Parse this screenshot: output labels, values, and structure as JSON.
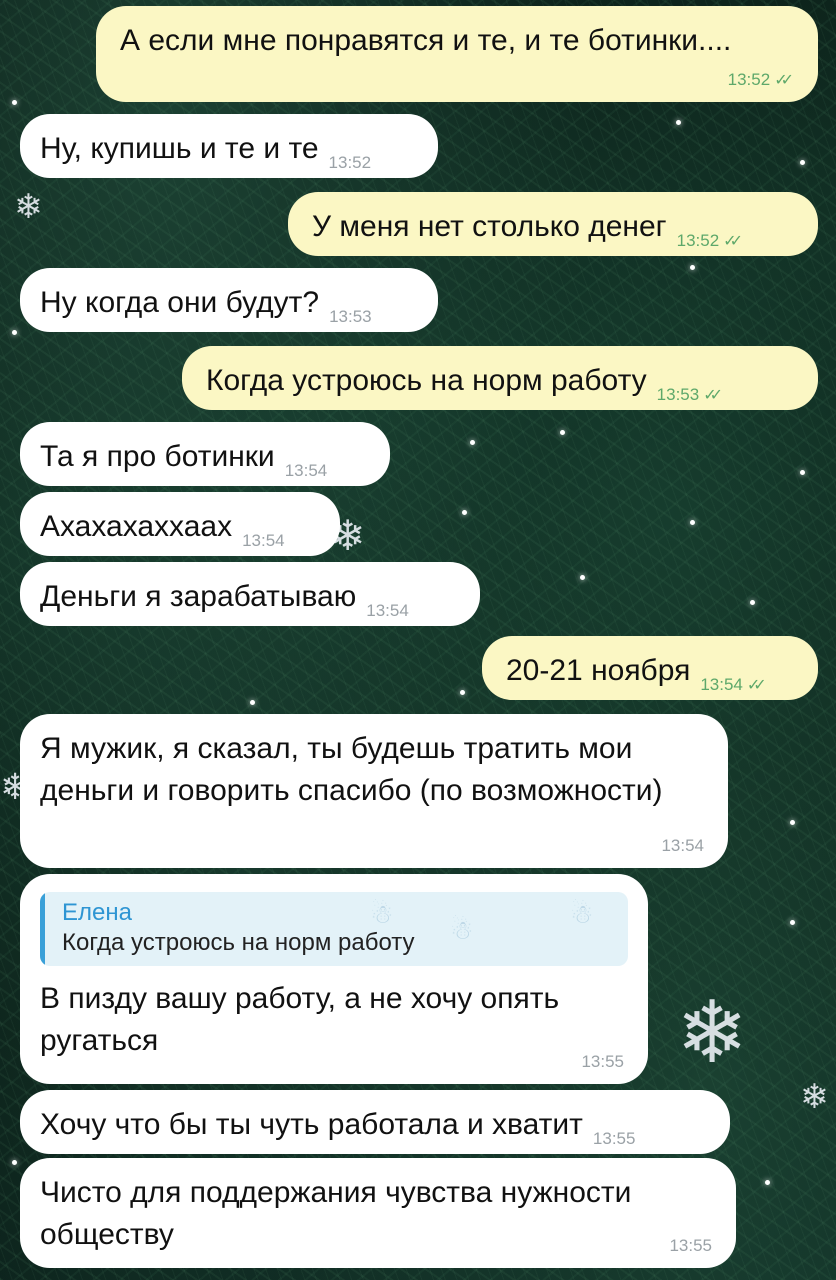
{
  "chat": {
    "messages": [
      {
        "text": "А если мне понравятся и те, и те ботинки....",
        "time": "13:52"
      },
      {
        "text": "Ну, купишь и те и те",
        "time": "13:52"
      },
      {
        "text": "У меня нет столько денег",
        "time": "13:52"
      },
      {
        "text": "Ну когда они будут?",
        "time": "13:53"
      },
      {
        "text": "Когда устроюсь на норм работу",
        "time": "13:53"
      },
      {
        "text": "Та я про ботинки",
        "time": "13:54"
      },
      {
        "text": "Ахахахаххаах",
        "time": "13:54"
      },
      {
        "text": "Деньги я зарабатываю",
        "time": "13:54"
      },
      {
        "text": "20-21 ноября",
        "time": "13:54"
      },
      {
        "text": "Я мужик, я сказал, ты будешь тратить мои деньги и говорить спасибо (по возможности)",
        "time": "13:54"
      },
      {
        "text": "В пизду вашу работу, а не хочу опять ругаться",
        "time": "13:55",
        "reply": {
          "author": "Елена",
          "text": "Когда устроюсь на норм работу"
        }
      },
      {
        "text": "Хочу что бы ты чуть работала и хватит",
        "time": "13:55"
      },
      {
        "text": "Чисто для поддержания чувства нужности обществу",
        "time": "13:55"
      }
    ]
  },
  "colors": {
    "outgoing_bubble": "#fbf7c4",
    "incoming_bubble": "#ffffff",
    "outgoing_time": "#5ea86a",
    "incoming_time": "#9aa1a6",
    "reply_accent": "#3aa0d8",
    "background": "#0f2a20"
  },
  "icons": {
    "read_status": "double-check-icon"
  }
}
